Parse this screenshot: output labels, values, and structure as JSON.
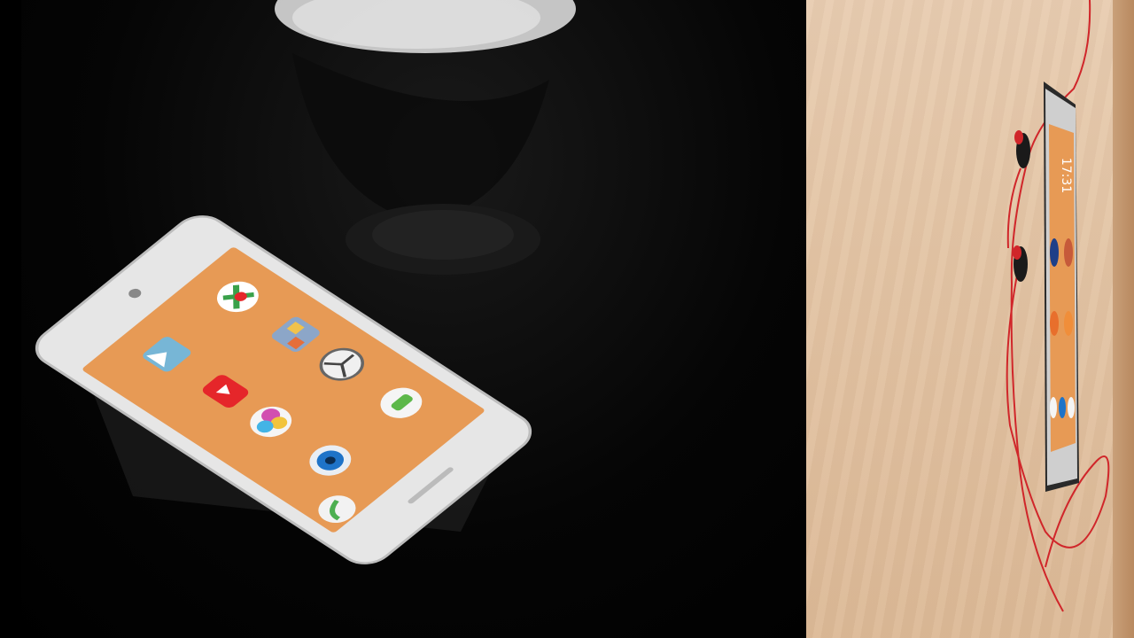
{
  "scene": {
    "left_panel": "phone-on-dark-surface",
    "right_panel": "phone-on-plywood-wall"
  },
  "left_phone": {
    "screen_color": "#e79a55",
    "body_color": "#e6e6e6",
    "icons": [
      {
        "name": "maps-icon",
        "color": "#3aa14a"
      },
      {
        "name": "photos-icon",
        "color": "#8ca6c8"
      },
      {
        "name": "car-logo-icon",
        "color": "#444444"
      },
      {
        "name": "gallery-icon",
        "color": "#77b6d6"
      },
      {
        "name": "youtube-icon",
        "color": "#e5262a"
      },
      {
        "name": "chat-bubble-icon",
        "color": "#5db84a"
      },
      {
        "name": "colorful-ball-icon",
        "color": "#d24fb0"
      },
      {
        "name": "camera-icon",
        "color": "#1e73c8"
      },
      {
        "name": "phone-call-icon",
        "color": "#4caf50"
      }
    ]
  },
  "right_phone": {
    "screen_color": "#e79a55",
    "clock": "17:31",
    "cable_color": "#d0262a"
  }
}
